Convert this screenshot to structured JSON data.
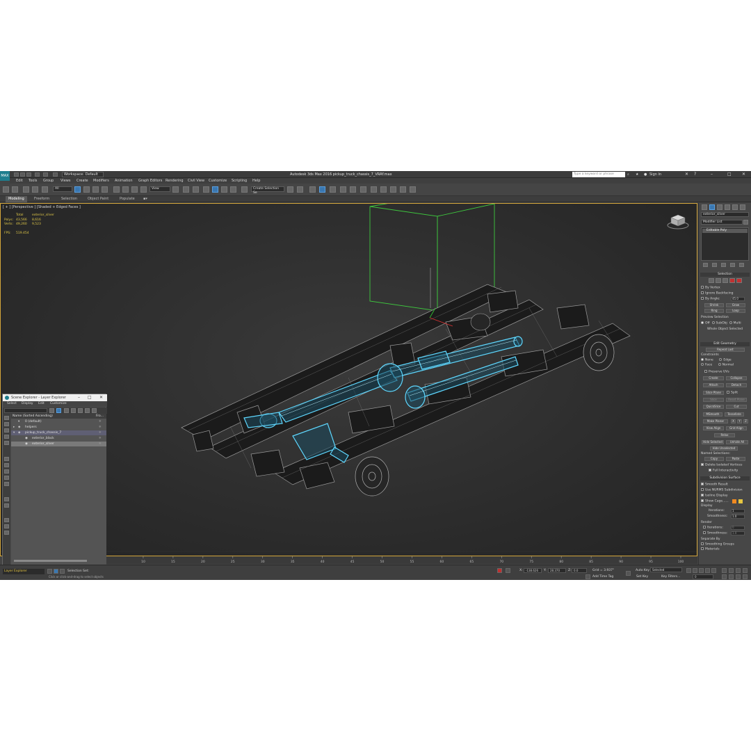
{
  "window": {
    "title": "Autodesk 3ds Max 2016    pickup_truck_chassis_7_VRAY.max",
    "workspace": "Workspace: Default",
    "search_placeholder": "Type a keyword or phrase",
    "sign_in": "Sign In"
  },
  "menu": [
    "Edit",
    "Tools",
    "Group",
    "Views",
    "Create",
    "Modifiers",
    "Animation",
    "Graph Editors",
    "Rendering",
    "Civil View",
    "Customize",
    "Scripting",
    "Help"
  ],
  "toolbar": {
    "filter": "All",
    "ref_coord": "View",
    "selection_set": "Create Selection Se"
  },
  "ribbon_tabs": [
    "Modeling",
    "Freeform",
    "Selection",
    "Object Paint",
    "Populate"
  ],
  "viewport": {
    "label": "[ + ] [Perspective ] [Shaded + Edged Faces ]",
    "stats": {
      "header": [
        "Total",
        "exterior_silver"
      ],
      "polys_label": "Polys:",
      "polys_total": "43,566",
      "polys_sel": "8,616",
      "verts_label": "Verts:",
      "verts_total": "49,260",
      "verts_sel": "9,523",
      "fps_label": "FPS:",
      "fps": "519.454"
    }
  },
  "command_panel": {
    "object_name": "exterior_silver",
    "modifier_list": "Modifier List",
    "stack_item": "Editable Poly",
    "selection": {
      "title": "Selection",
      "by_vertex": "By Vertex",
      "ignore_backfacing": "Ignore Backfacing",
      "by_angle": "By Angle:",
      "angle_val": "45.0",
      "shrink": "Shrink",
      "grow": "Grow",
      "ring": "Ring",
      "loop": "Loop",
      "preview": "Preview Selection",
      "off": "Off",
      "subobj": "SubObj",
      "multi": "Multi",
      "whole_object": "Whole Object Selected"
    },
    "edit_geometry": {
      "title": "Edit Geometry",
      "repeat_last": "Repeat Last",
      "constraints": "Constraints",
      "none": "None",
      "edge": "Edge",
      "face": "Face",
      "normal": "Normal",
      "preserve_uvs": "Preserve UVs",
      "create": "Create",
      "collapse": "Collapse",
      "attach": "Attach",
      "detach": "Detach",
      "slice_plane": "Slice Plane",
      "split": "Split",
      "slice": "Slice",
      "reset_plane": "Reset Plane",
      "quickslice": "QuickSlice",
      "cut": "Cut",
      "msmooth": "MSmooth",
      "tessellate": "Tessellate",
      "make_planar": "Make Planar",
      "x": "X",
      "y": "Y",
      "z": "Z",
      "view_align": "View Align",
      "grid_align": "Grid Align",
      "relax": "Relax",
      "hide_selected": "Hide Selected",
      "unhide_all": "Unhide All",
      "hide_unselected": "Hide Unselected",
      "named_selections": "Named Selections:",
      "copy": "Copy",
      "paste": "Paste",
      "delete_isolated": "Delete Isolated Vertices",
      "full_interactivity": "Full Interactivity"
    },
    "subdivision": {
      "title": "Subdivision Surface",
      "smooth_result": "Smooth Result",
      "use_nurms": "Use NURMS Subdivision",
      "isoline": "Isoline Display",
      "show_cage": "Show Cage......",
      "display": "Display",
      "iterations_label": "Iterations:",
      "iterations": "1",
      "smoothness_label": "Smoothness:",
      "smoothness": "1.0",
      "render": "Render",
      "r_iterations": "0",
      "r_smoothness": "1.0",
      "separate_by": "Separate By",
      "smoothing_groups": "Smoothing Groups",
      "materials": "Materials"
    }
  },
  "scene_explorer": {
    "title": "Scene Explorer - Layer Explorer",
    "menu": [
      "Select",
      "Display",
      "Edit",
      "Customize"
    ],
    "column_name": "Name (Sorted Ascending)",
    "column_fro": "Fro...",
    "rows": [
      "0 (default)",
      "helpers",
      "pickup_truck_chassis_7",
      "exterior_black",
      "exterior_silver"
    ],
    "footer_label": "Layer Explorer",
    "selection_set": "Selection Set:"
  },
  "timeline": {
    "ticks": [
      "10",
      "15",
      "20",
      "25",
      "30",
      "35",
      "40",
      "45",
      "50",
      "55",
      "60",
      "65",
      "70",
      "75",
      "80",
      "85",
      "90",
      "95",
      "100"
    ]
  },
  "status": {
    "x_label": "X:",
    "x": "-138.626",
    "y_label": "Y:",
    "y": "28.370",
    "z_label": "Z:",
    "z": "0.0",
    "grid": "Grid = 3.937\"",
    "auto_key": "Auto Key",
    "key_mode": "Selected",
    "set_key": "Set Key",
    "key_filters": "Key Filters...",
    "add_time_tag": "Add Time Tag",
    "hint": "Click or click-and-drag to select objects",
    "frame": "0"
  },
  "colors": {
    "accent": "#3a77b0",
    "selection_wire": "#5fd8ff",
    "bbox_green": "#3ec83e",
    "viewport_border": "#d4a63a",
    "stats_yellow": "#e0c848"
  }
}
